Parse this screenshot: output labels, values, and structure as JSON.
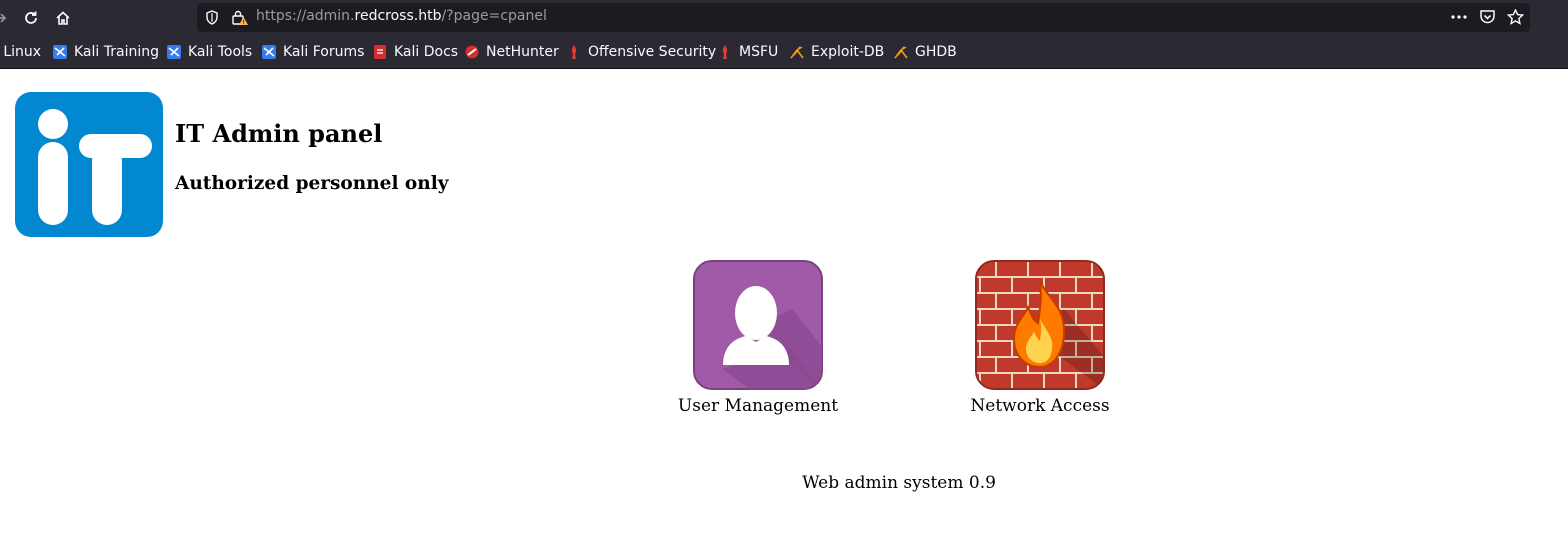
{
  "browser": {
    "url_scheme": "https://",
    "url_sub": "admin.",
    "url_domain": "redcross.htb",
    "url_path": "/?page=cpanel"
  },
  "bookmarks": [
    {
      "label": "i Linux",
      "icon": "kali-dragon-icon"
    },
    {
      "label": "Kali Training",
      "icon": "kali-dragon-icon"
    },
    {
      "label": "Kali Tools",
      "icon": "kali-dragon-icon"
    },
    {
      "label": "Kali Forums",
      "icon": "kali-dragon-icon"
    },
    {
      "label": "Kali Docs",
      "icon": "kali-docs-icon"
    },
    {
      "label": "NetHunter",
      "icon": "nethunter-icon"
    },
    {
      "label": "Offensive Security",
      "icon": "offsec-icon"
    },
    {
      "label": "MSFU",
      "icon": "offsec-icon"
    },
    {
      "label": "Exploit-DB",
      "icon": "exploit-db-icon"
    },
    {
      "label": "GHDB",
      "icon": "exploit-db-icon"
    }
  ],
  "page": {
    "title": "IT Admin panel",
    "subtitle": "Authorized personnel only",
    "apps": [
      {
        "label": "User Management",
        "icon": "user-icon"
      },
      {
        "label": "Network Access",
        "icon": "firewall-icon"
      }
    ],
    "footer": "Web admin system 0.9"
  },
  "colors": {
    "chrome_bg": "#2b2a33",
    "urlbar_bg": "#1c1b22",
    "logo_blue": "#0288d1",
    "user_purple": "#a05aa8",
    "brick_red": "#c0392b",
    "flame_orange": "#ff7a00"
  }
}
